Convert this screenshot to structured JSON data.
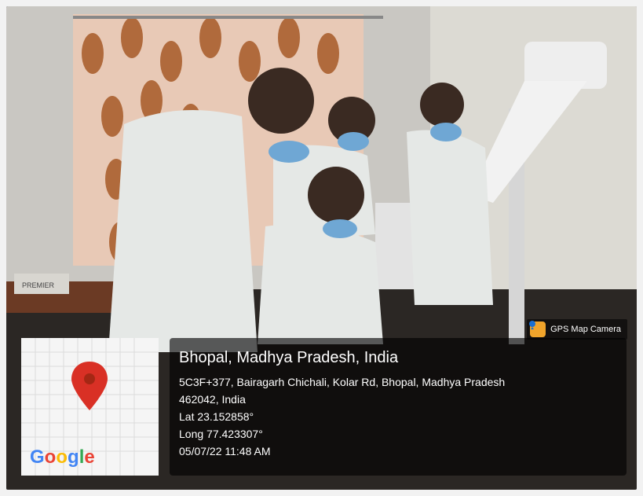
{
  "overlay": {
    "app_badge": "GPS Map Camera",
    "location_title": "Bhopal, Madhya Pradesh, India",
    "address_line1": "5C3F+377, Bairagarh Chichali, Kolar Rd, Bhopal, Madhya Pradesh",
    "address_line2": "462042, India",
    "lat": "Lat 23.152858°",
    "long": "Long 77.423307°",
    "datetime": "05/07/22 11:48 AM"
  },
  "map": {
    "logo_text": "Google",
    "pin_icon": "map-pin-icon",
    "pin_color": "#d93025"
  },
  "photo": {
    "description_icon": "photo-scene",
    "product_label": "PREMIER"
  }
}
